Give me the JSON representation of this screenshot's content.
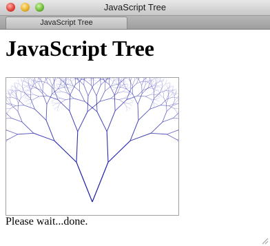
{
  "window": {
    "title": "JavaScript Tree"
  },
  "tab": {
    "label": "JavaScript Tree"
  },
  "page": {
    "heading": "JavaScript Tree",
    "status": "Please wait...done."
  },
  "colors": {
    "branch": "#1a1aa6"
  }
}
